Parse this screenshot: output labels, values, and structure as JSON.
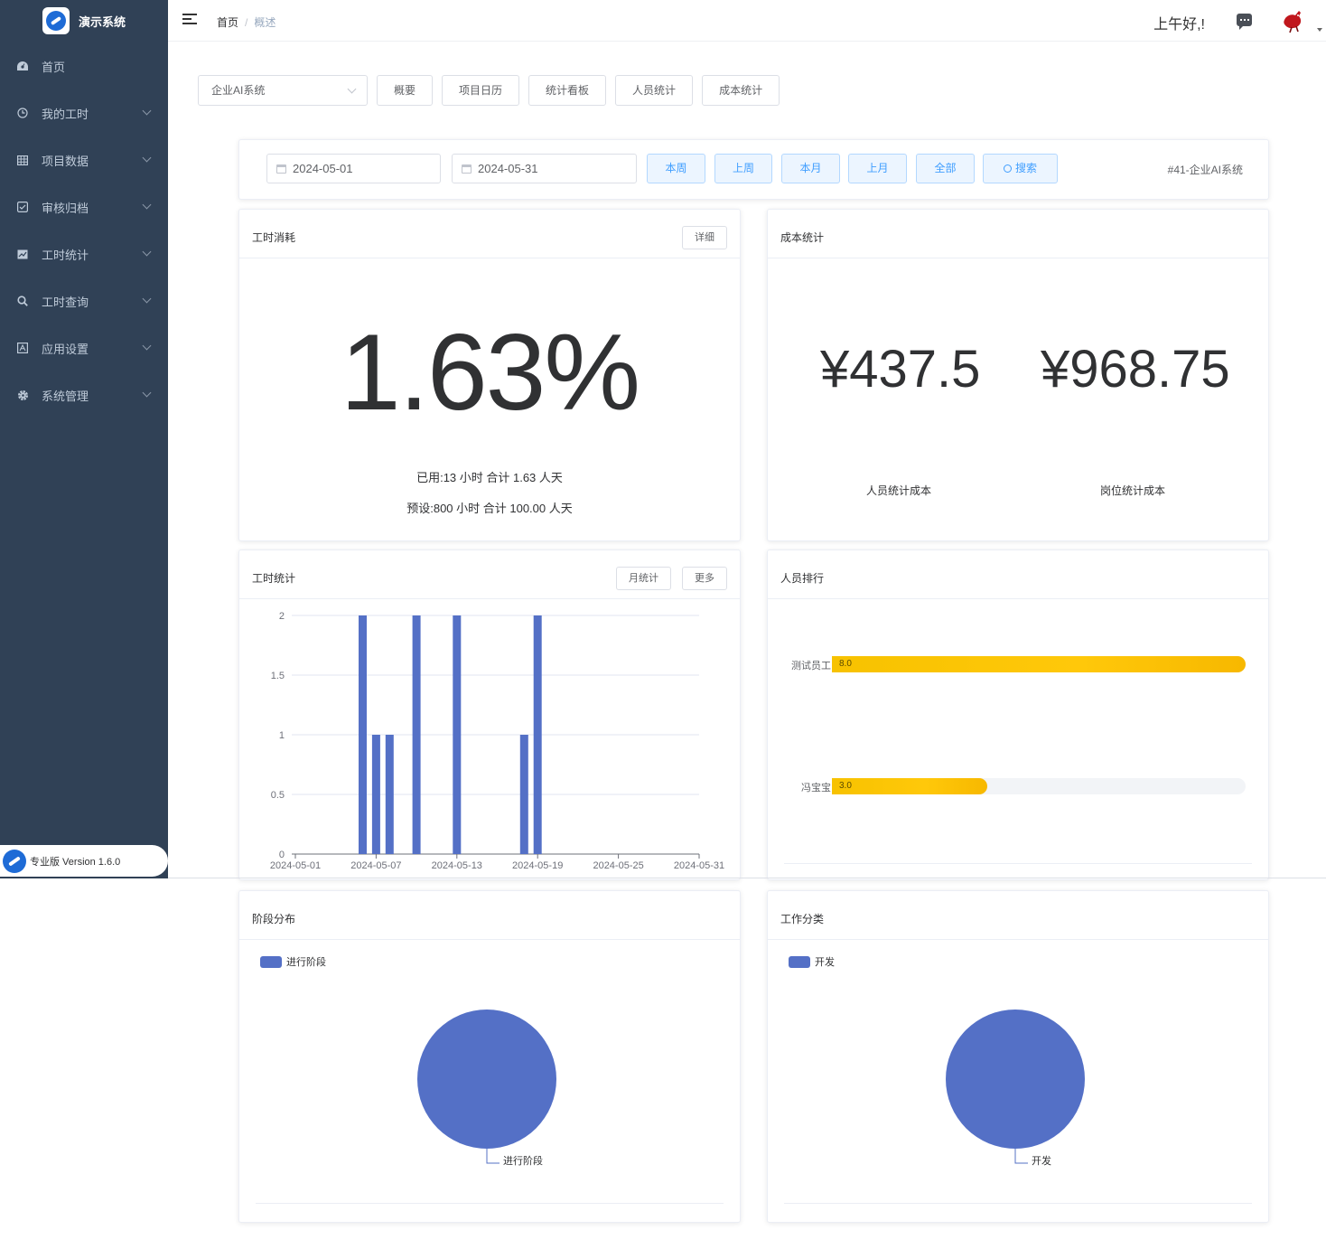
{
  "brand": {
    "title": "演示系统"
  },
  "sidebar": {
    "items": [
      {
        "label": "首页",
        "icon": "dashboard-icon"
      },
      {
        "label": "我的工时",
        "icon": "clock-icon"
      },
      {
        "label": "项目数据",
        "icon": "table-icon"
      },
      {
        "label": "审核归档",
        "icon": "checkbox-icon"
      },
      {
        "label": "工时统计",
        "icon": "chart-icon"
      },
      {
        "label": "工时查询",
        "icon": "search-icon"
      },
      {
        "label": "应用设置",
        "icon": "settings-icon"
      },
      {
        "label": "系统管理",
        "icon": "gear-icon"
      }
    ],
    "version": "专业版 Version 1.6.0"
  },
  "header": {
    "breadcrumb_home": "首页",
    "breadcrumb_sep": "/",
    "breadcrumb_current": "概述",
    "greeting": "上午好,!"
  },
  "toolbar": {
    "project_select": "企业AI系统",
    "buttons": [
      "概要",
      "项目日历",
      "统计看板",
      "人员统计",
      "成本统计"
    ]
  },
  "filter": {
    "start_date": "2024-05-01",
    "end_date": "2024-05-31",
    "quick": [
      "本周",
      "上周",
      "本月",
      "上月",
      "全部"
    ],
    "search": "搜索",
    "project_tag": "#41-企业AI系统"
  },
  "hours_consumption": {
    "title": "工时消耗",
    "detail_btn": "详细",
    "percent": "1.63%",
    "used_line": "已用:13 小时 合计 1.63 人天",
    "plan_line": "预设:800 小时 合计 100.00 人天"
  },
  "cost": {
    "title": "成本统计",
    "person_cost": "¥437.5",
    "post_cost": "¥968.75",
    "person_label": "人员统计成本",
    "post_label": "岗位统计成本"
  },
  "hours_stats": {
    "title": "工时统计",
    "month_btn": "月统计",
    "more_btn": "更多"
  },
  "ranking": {
    "title": "人员排行",
    "max": 8.0,
    "rows": [
      {
        "name": "测试员工",
        "value": 8.0,
        "label": "8.0"
      },
      {
        "name": "冯宝宝",
        "value": 3.0,
        "label": "3.0"
      }
    ]
  },
  "stage": {
    "title": "阶段分布",
    "legend": "进行阶段",
    "slice_label": "进行阶段"
  },
  "worktype": {
    "title": "工作分类",
    "legend": "开发",
    "slice_label": "开发"
  },
  "colors": {
    "sidebar": "#304156",
    "series": "#5470c6",
    "accent": "#409eff",
    "rank": "#ffc80a"
  },
  "chart_data": [
    {
      "type": "bar",
      "x": [
        "2024-05-01",
        "2024-05-02",
        "2024-05-03",
        "2024-05-04",
        "2024-05-05",
        "2024-05-06",
        "2024-05-07",
        "2024-05-08",
        "2024-05-09",
        "2024-05-10",
        "2024-05-11",
        "2024-05-12",
        "2024-05-13",
        "2024-05-14",
        "2024-05-15",
        "2024-05-16",
        "2024-05-17",
        "2024-05-18",
        "2024-05-19",
        "2024-05-20",
        "2024-05-21",
        "2024-05-22",
        "2024-05-23",
        "2024-05-24",
        "2024-05-25",
        "2024-05-26",
        "2024-05-27",
        "2024-05-28",
        "2024-05-29",
        "2024-05-30",
        "2024-05-31"
      ],
      "values": [
        0,
        0,
        0,
        0,
        0,
        2,
        1,
        1,
        0,
        2,
        0,
        0,
        2,
        0,
        0,
        0,
        0,
        1,
        2,
        0,
        0,
        0,
        0,
        0,
        0,
        0,
        0,
        0,
        0,
        0,
        0
      ],
      "x_tick_labels": [
        "2024-05-01",
        "2024-05-07",
        "2024-05-13",
        "2024-05-19",
        "2024-05-25",
        "2024-05-31"
      ],
      "y_ticks": [
        "0",
        "0.5",
        "1",
        "1.5",
        "2"
      ],
      "ylim": [
        0,
        2
      ],
      "grid": true
    },
    {
      "type": "bar",
      "categories": [
        "测试员工",
        "冯宝宝"
      ],
      "values": [
        8.0,
        3.0
      ]
    },
    {
      "type": "pie",
      "categories": [
        "进行阶段"
      ],
      "values": [
        100
      ]
    },
    {
      "type": "pie",
      "categories": [
        "开发"
      ],
      "values": [
        100
      ]
    }
  ]
}
